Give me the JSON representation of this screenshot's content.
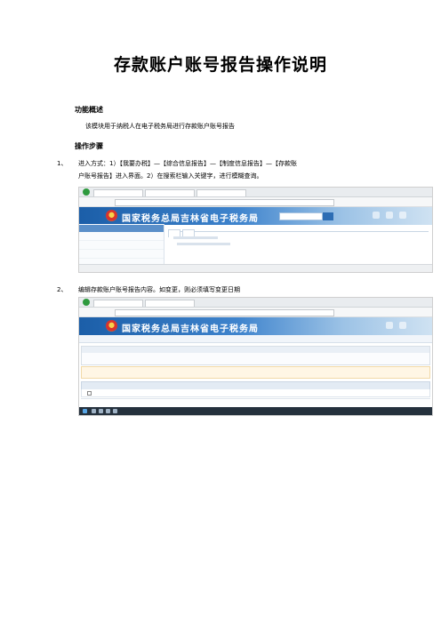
{
  "title": "存款账户账号报告操作说明",
  "overview": {
    "heading": "功能概述",
    "text": "该模块用于纳税人在电子税务局进行存款账户账号报告"
  },
  "steps": {
    "heading": "操作步骤",
    "step1": {
      "num": "1、",
      "line1": "进入方式：1）【我要办税】—【综合信息报告】—【制度信息报告】—【存款账",
      "line2": "户账号报告】进入界面。2）在搜索栏输入关键字，进行模糊查询。"
    },
    "step2": {
      "num": "2、",
      "text": "编辑存款账户账号报告内容。如变更，则必须填写变更日期"
    }
  },
  "colors": {
    "banner": "#1b5ea8",
    "sidebar_group": "#5a8fc9",
    "notice": "#d3342b"
  },
  "screenshot1": {
    "banner_title": "国家税务总局吉林省电子税务局"
  },
  "screenshot2": {
    "banner_title": "国家税务总局吉林省电子税务局"
  }
}
